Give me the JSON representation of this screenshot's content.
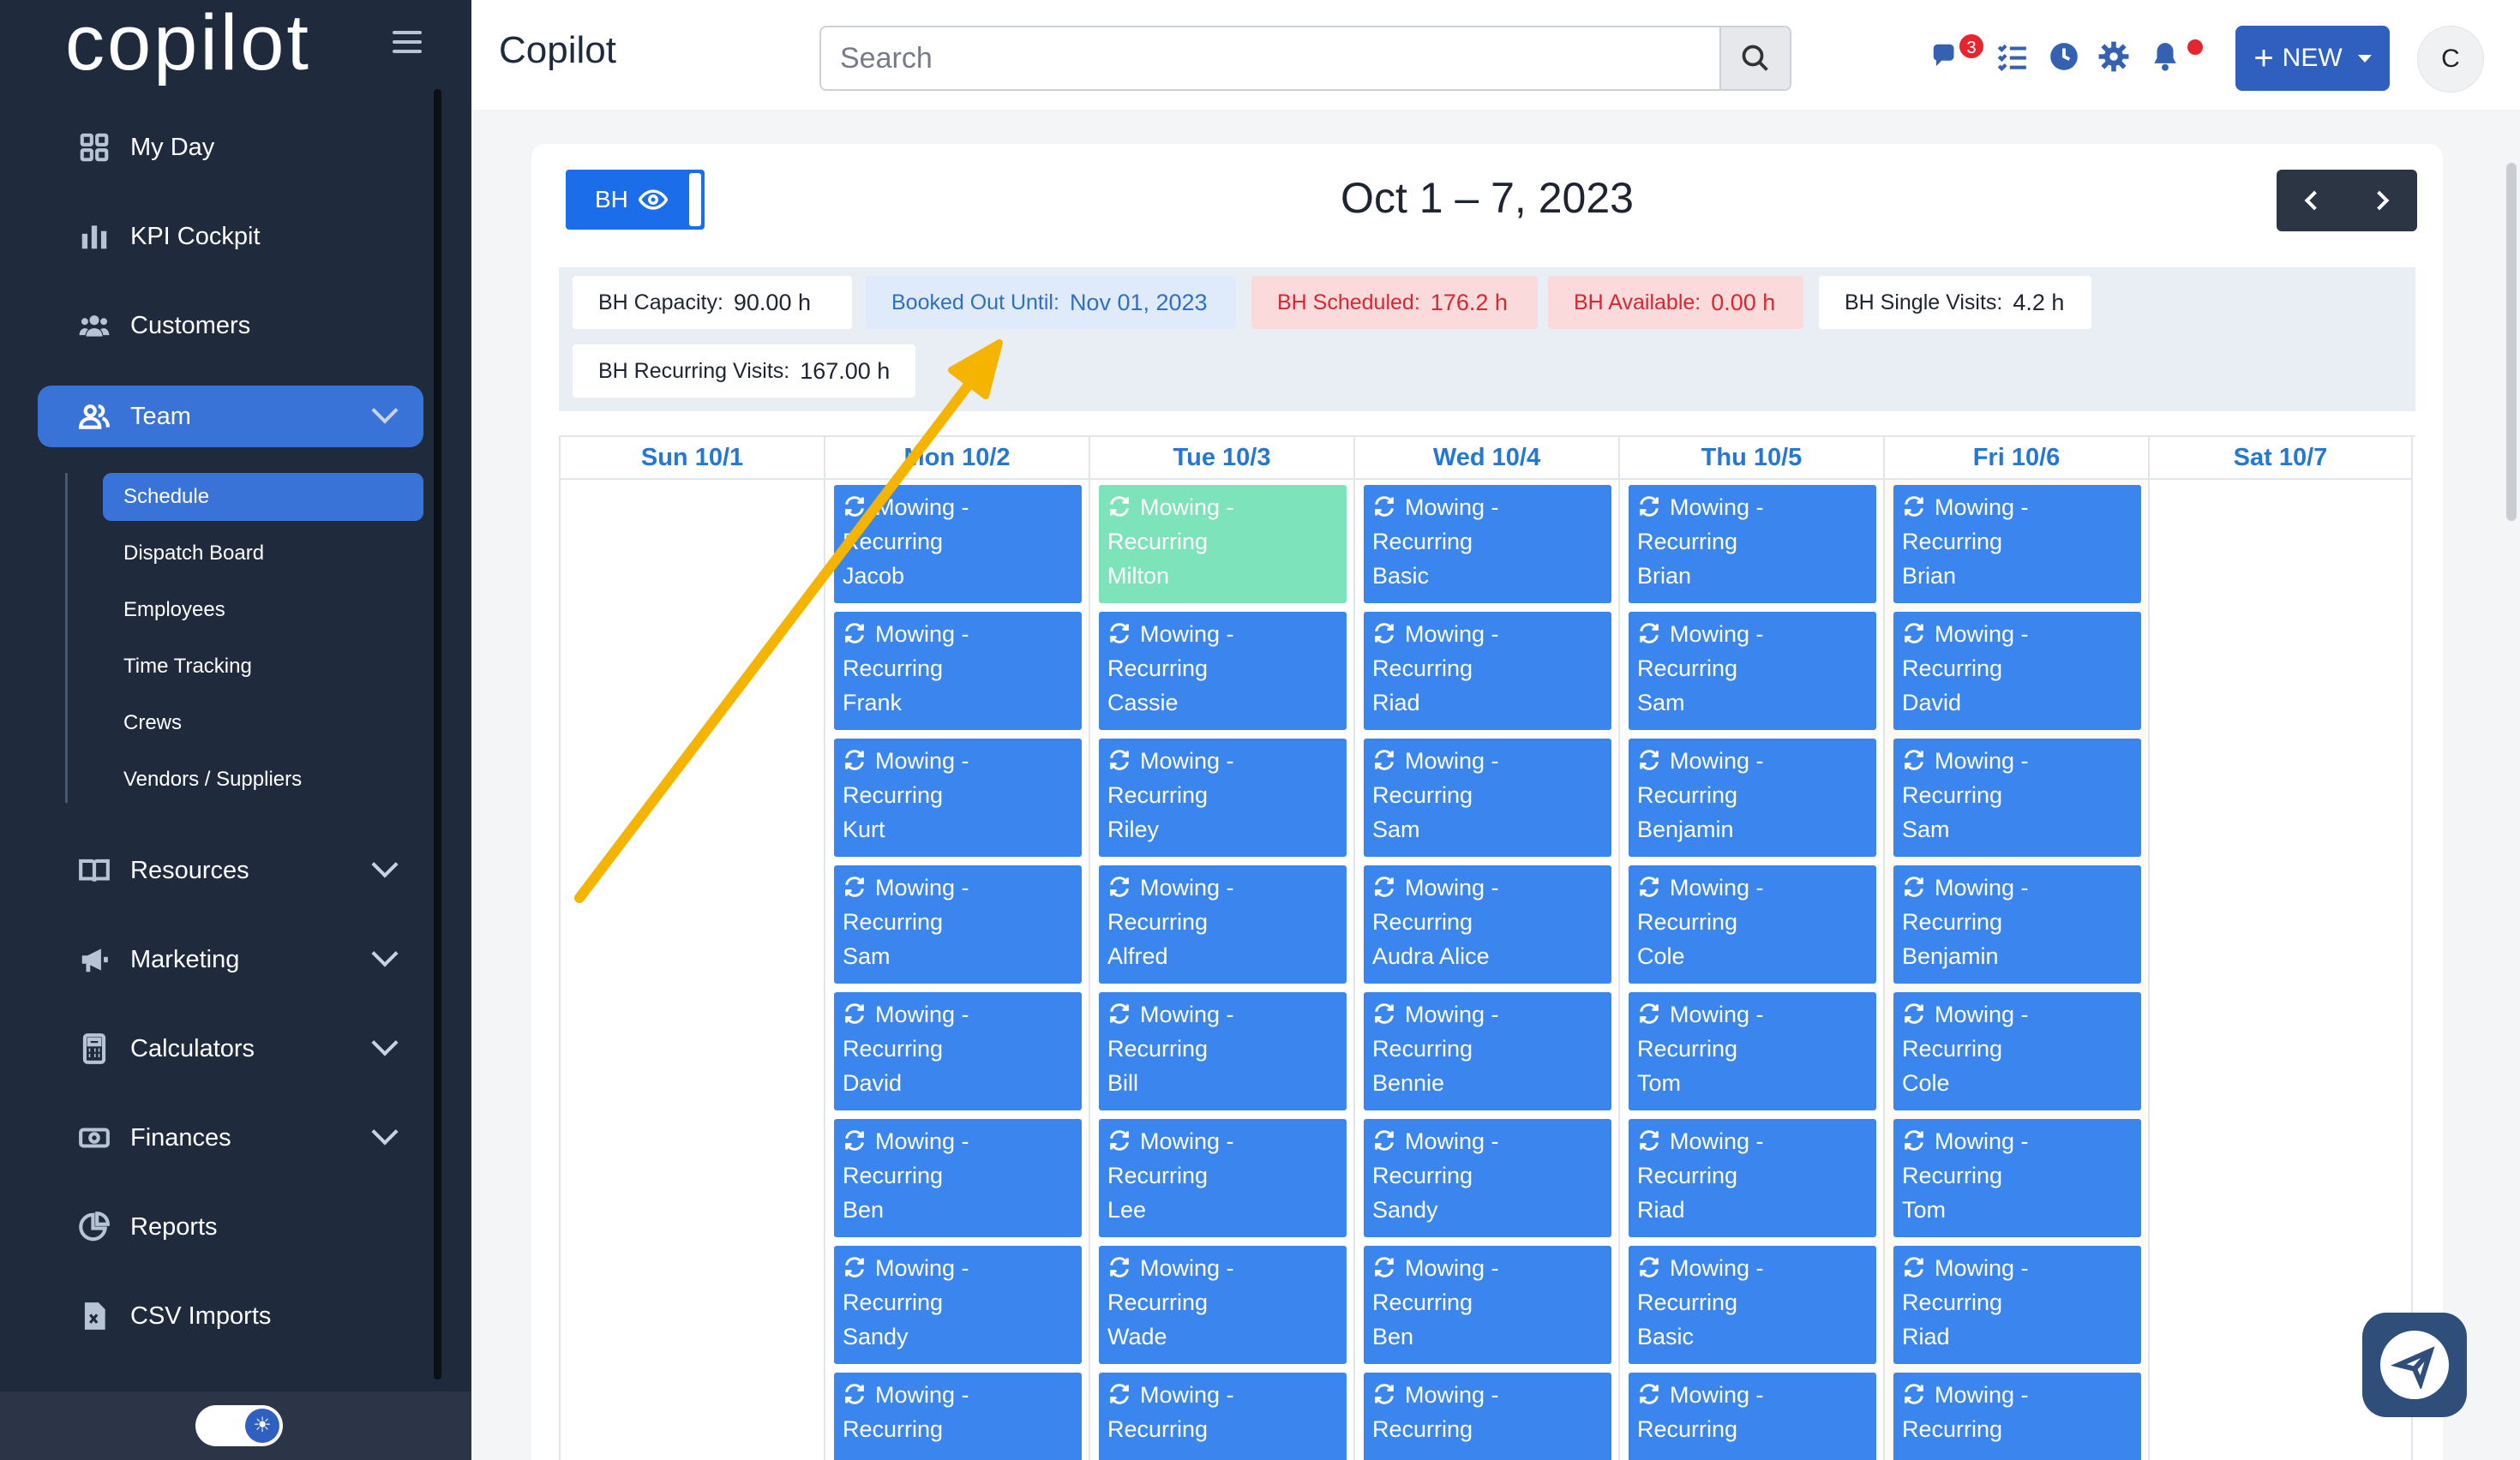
{
  "sidebar": {
    "logo": "copilot",
    "items": [
      {
        "id": "my-day",
        "label": "My Day",
        "icon": "grid-icon"
      },
      {
        "id": "kpi-cockpit",
        "label": "KPI Cockpit",
        "icon": "bar-chart-icon"
      },
      {
        "id": "customers",
        "label": "Customers",
        "icon": "users-icon"
      },
      {
        "id": "team",
        "label": "Team",
        "icon": "user-group-icon",
        "active": true
      },
      {
        "id": "resources",
        "label": "Resources",
        "icon": "book-icon"
      },
      {
        "id": "marketing",
        "label": "Marketing",
        "icon": "megaphone-icon"
      },
      {
        "id": "calculators",
        "label": "Calculators",
        "icon": "calculator-icon"
      },
      {
        "id": "finances",
        "label": "Finances",
        "icon": "money-icon"
      },
      {
        "id": "reports",
        "label": "Reports",
        "icon": "pie-chart-icon"
      },
      {
        "id": "csv-imports",
        "label": "CSV Imports",
        "icon": "csv-file-icon"
      }
    ],
    "team_sub": [
      {
        "label": "Schedule",
        "active": true
      },
      {
        "label": "Dispatch Board"
      },
      {
        "label": "Employees"
      },
      {
        "label": "Time Tracking"
      },
      {
        "label": "Crews"
      },
      {
        "label": "Vendors / Suppliers"
      }
    ]
  },
  "header": {
    "title": "Copilot",
    "search_placeholder": "Search",
    "chat_badge": "3",
    "new_label": "NEW",
    "avatar_initial": "C"
  },
  "schedule": {
    "bh_label": "BH",
    "week_title": "Oct 1 – 7, 2023",
    "stats": [
      {
        "label": "BH Capacity:",
        "value": "90.00 h",
        "style": "white"
      },
      {
        "label": "Booked Out Until:",
        "value": "Nov 01, 2023",
        "style": "blue"
      },
      {
        "label": "BH Scheduled:",
        "value": "176.2 h",
        "style": "red"
      },
      {
        "label": "BH Available:",
        "value": "0.00 h",
        "style": "red"
      },
      {
        "label": "BH Single Visits:",
        "value": "4.2 h",
        "style": "white"
      },
      {
        "label": "BH Recurring Visits:",
        "value": "167.00 h",
        "style": "white"
      }
    ],
    "days": [
      {
        "label": "Sun 10/1",
        "events": []
      },
      {
        "label": "Mon 10/2",
        "events": [
          "Jacob",
          "Frank",
          "Kurt",
          "Sam",
          "David",
          "Ben",
          "Sandy",
          ""
        ]
      },
      {
        "label": "Tue 10/3",
        "events": [
          "Milton",
          "Cassie",
          "Riley",
          "Alfred",
          "Bill",
          "Lee",
          "Wade",
          ""
        ]
      },
      {
        "label": "Wed 10/4",
        "events": [
          "Basic",
          "Riad",
          "Sam",
          "Audra Alice",
          "Bennie",
          "Sandy",
          "Ben",
          ""
        ]
      },
      {
        "label": "Thu 10/5",
        "events": [
          "Brian",
          "Sam",
          "Benjamin",
          "Cole",
          "Tom",
          "Riad",
          "Basic",
          ""
        ]
      },
      {
        "label": "Fri 10/6",
        "events": [
          "Brian",
          "David",
          "Sam",
          "Benjamin",
          "Cole",
          "Tom",
          "Riad",
          ""
        ]
      },
      {
        "label": "Sat 10/7",
        "events": []
      }
    ],
    "event_line1": "Mowing -",
    "event_line2": "Recurring",
    "highlight_event": {
      "day": 2,
      "index": 0,
      "color": "#7de3bb"
    }
  },
  "colors": {
    "sidebar_bg": "#1f2a3d",
    "accent": "#3a73d8",
    "event_blue": "#3b86ee",
    "annotation_arrow": "#f5b400"
  }
}
